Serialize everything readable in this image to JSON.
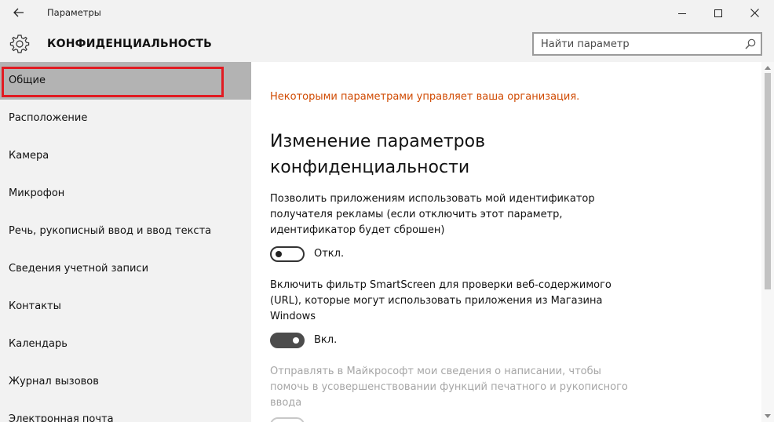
{
  "window": {
    "title": "Параметры"
  },
  "header": {
    "title": "КОНФИДЕНЦИАЛЬНОСТЬ",
    "search_placeholder": "Найти параметр"
  },
  "sidebar": {
    "items": [
      {
        "label": "Общие",
        "active": true,
        "highlighted": true
      },
      {
        "label": "Расположение"
      },
      {
        "label": "Камера"
      },
      {
        "label": "Микрофон"
      },
      {
        "label": "Речь, рукописный ввод и ввод текста"
      },
      {
        "label": "Сведения учетной записи"
      },
      {
        "label": "Контакты"
      },
      {
        "label": "Календарь"
      },
      {
        "label": "Журнал вызовов"
      },
      {
        "label": "Электронная почта"
      }
    ]
  },
  "content": {
    "org_note": "Некоторыми параметрами управляет ваша организация.",
    "section_title": "Изменение параметров конфиденциальности",
    "settings": [
      {
        "text": "Позволить приложениям использовать мой идентификатор получателя рекламы (если отключить этот параметр, идентификатор будет сброшен)",
        "state": "off",
        "state_label": "Откл."
      },
      {
        "text": "Включить фильтр SmartScreen для проверки веб-содержимого (URL), которые могут использовать приложения из Магазина Windows",
        "state": "on",
        "state_label": "Вкл."
      },
      {
        "text": "Отправлять в Майкрософт мои сведения о написании, чтобы помочь в усовершенствовании функций печатного и рукописного ввода",
        "state": "disabled"
      }
    ]
  },
  "colors": {
    "org_note": "#d04a02",
    "highlight_frame": "#e11b22",
    "active_item": "#b3b3b3",
    "chrome": "#f2f2f2"
  },
  "icons": {
    "back": "back-arrow-icon",
    "minimize": "minimize-icon",
    "maximize": "maximize-icon",
    "close": "close-icon",
    "settings": "gear-icon",
    "search": "search-icon"
  }
}
